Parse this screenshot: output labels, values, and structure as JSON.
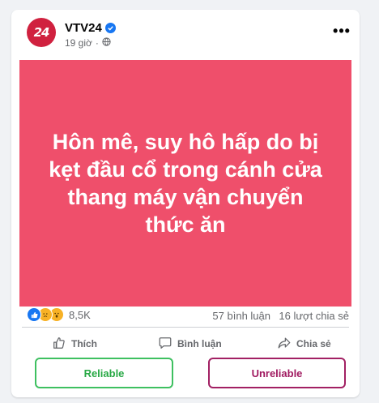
{
  "header": {
    "avatar_text": "24",
    "page_name": "VTV24",
    "time": "19 giờ",
    "more_label": "•••",
    "verified_icon": "verified-badge-icon",
    "audience_icon": "globe-icon"
  },
  "post": {
    "headline": "Hôn mê, suy hô hấp do bị kẹt đầu cổ trong cánh cửa thang máy vận chuyển thức ăn",
    "background_color": "#ef4f6b"
  },
  "stats": {
    "reaction_count": "8,5K",
    "comments": "57 bình luận",
    "shares": "16 lượt chia sẻ",
    "reaction_icons": [
      "like-icon",
      "sad-icon",
      "wow-icon"
    ]
  },
  "actions": {
    "like": "Thích",
    "comment": "Bình luận",
    "share": "Chia sẻ"
  },
  "rating": {
    "reliable": "Reliable",
    "unreliable": "Unreliable"
  },
  "colors": {
    "brand": "#d0213f",
    "reliable": "#3ec060",
    "unreliable": "#a22063"
  }
}
